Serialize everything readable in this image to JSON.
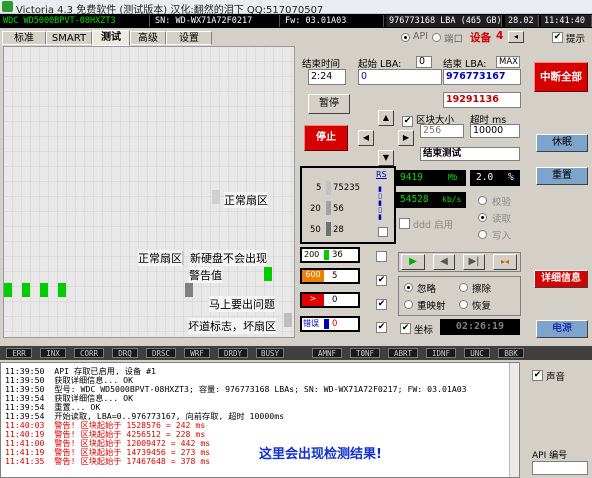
{
  "window": {
    "title": "Victoria 4.3 免费软件 (测试版本) 汉化:翻然的泪下 QQ:517070507"
  },
  "info": {
    "model": "WDC WD5000BPVT-08HXZT3",
    "serial": "SN: WD-WX71A72F0217",
    "firmware": "Fw: 03.01A03",
    "capacity": "976773168 LBA (465 GB)",
    "date": "28.02",
    "time": "11:41:40"
  },
  "tabs": [
    "标准",
    "SMART",
    "测试",
    "高级",
    "设置"
  ],
  "selected_tab": "测试",
  "top_controls": {
    "api": "API",
    "port": "端口",
    "device_label": "设备",
    "device_value": "4",
    "hint": "提示"
  },
  "grid": {
    "label_normal_1": "正常扇区",
    "label_normal_2": "正常扇区",
    "label_new": "新硬盘不会出现",
    "label_warning": "警告值",
    "label_soon": "马上要出问题",
    "label_bad": "坏道标志，坏扇区"
  },
  "controls": {
    "end_time_label": "结束时间",
    "end_time_value": "2:24",
    "start_lba_label": "起始 LBA:",
    "start_lba_value": "0",
    "end_lba_label": "结束 LBA:",
    "end_lba_max": "MAX",
    "end_lba_value": "976773167",
    "position_value": "19291136",
    "pause": "暂停",
    "stop": "停止",
    "block_size_label": "区块大小",
    "block_size_value": "256",
    "timeout_label": "超时 ms",
    "timeout_value": "10000",
    "end_test": "结束测试",
    "stop_all": "中断全部",
    "sleep": "休眠",
    "reset": "重置",
    "details": "详细信息",
    "power": "电源"
  },
  "stats": {
    "rs": "RS",
    "r5_label": "5",
    "r5_value": "75235",
    "r20_label": "20",
    "r20_value": "56",
    "r50_label": "50",
    "r50_value": "28",
    "r200_label": "200",
    "r200_value": "36",
    "r600_label": "600",
    "r600_value": "5",
    "rgt_label": ">",
    "rgt_value": "0",
    "err_label": "错误",
    "err_value": "0",
    "speed_value": "9419",
    "speed_unit": "Mb",
    "pct_value": "2.0",
    "pct_unit": "%",
    "kbs_value": "54528",
    "kbs_unit": "kb/s",
    "ddd": "ddd 启用",
    "grid_label": "坐标",
    "timer": "02:26:19"
  },
  "modes": {
    "verify": "校验",
    "read": "读取",
    "write": "写入",
    "ignore": "忽略",
    "erase": "擦除",
    "remap": "重映射",
    "restore": "恢复"
  },
  "statusbar": [
    "ERR",
    "INX",
    "CORR",
    "DRQ",
    "DRSC",
    "WRF",
    "DRDY",
    "BUSY",
    "AMNF",
    "T0NF",
    "ABRT",
    "IDNF",
    "UNC",
    "BBK"
  ],
  "log": [
    {
      "time": "11:39:50",
      "text": "API 存取已启用, 设备 #1",
      "warn": false
    },
    {
      "time": "11:39:50",
      "text": "获取详细信息... OK",
      "warn": false
    },
    {
      "time": "11:39:50",
      "text": "型号: WDC WD5000BPVT-08HXZT3;     容量: 976773168 LBAs; SN: WD-WX71A72F0217; FW: 03.01A03",
      "warn": false
    },
    {
      "time": "11:39:54",
      "text": "获取详细信息... OK",
      "warn": false
    },
    {
      "time": "11:39:54",
      "text": "重置... OK",
      "warn": false
    },
    {
      "time": "11:39:54",
      "text": "开始读取, LBA=0..976773167, 向前存取, 超时 10000ms",
      "warn": false
    },
    {
      "time": "11:40:03",
      "text": "警告! 区块起始于 1528576 = 242 ms",
      "warn": true
    },
    {
      "time": "11:40:19",
      "text": "警告! 区块起始于 4256512 = 228 ms",
      "warn": true
    },
    {
      "time": "11:41:00",
      "text": "警告! 区块起始于 12009472 = 442 ms",
      "warn": true
    },
    {
      "time": "11:41:19",
      "text": "警告! 区块起始于 14739456 = 273 ms",
      "warn": true
    },
    {
      "time": "11:41:35",
      "text": "警告! 区块起始于 17467648 = 378 ms",
      "warn": true
    }
  ],
  "log_overlay": "这里会出现检测结果!",
  "sound": "声音",
  "api_number": "API 编号"
}
